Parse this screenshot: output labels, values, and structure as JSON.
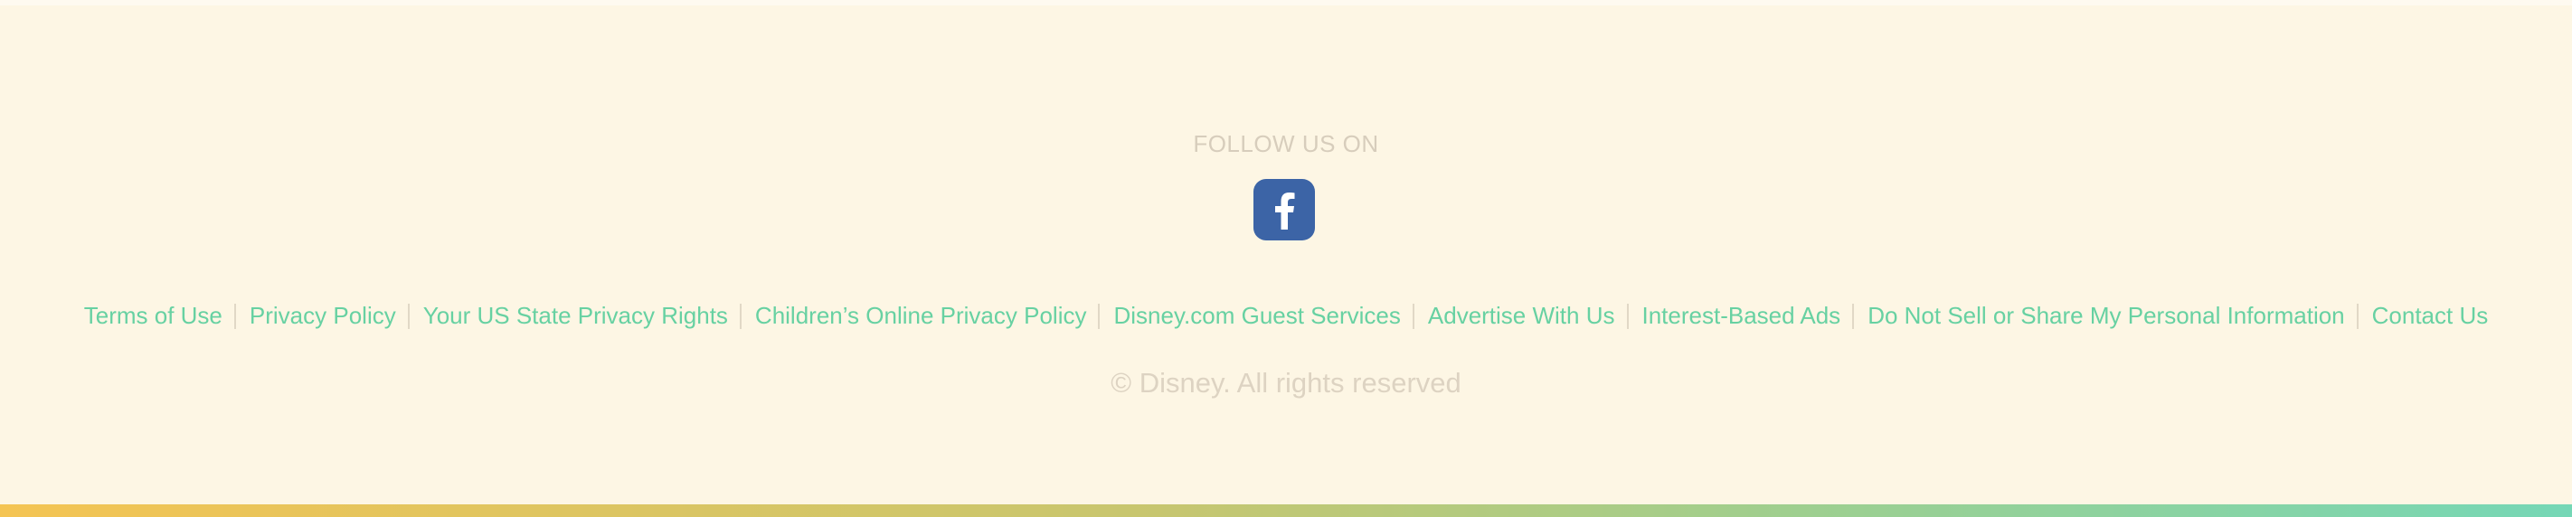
{
  "footer": {
    "follow_label": "FOLLOW US ON",
    "social": [
      {
        "name": "Facebook",
        "icon": "facebook-icon",
        "color": "#3c64a6"
      }
    ],
    "links": [
      "Terms of Use",
      "Privacy Policy",
      "Your US State Privacy Rights",
      "Children’s Online Privacy Policy",
      "Disney.com Guest Services",
      "Advertise With Us",
      "Interest-Based Ads",
      "Do Not Sell or Share My Personal Information",
      "Contact Us"
    ],
    "copyright": "© Disney. All rights reserved"
  },
  "colors": {
    "background": "#fdf6e4",
    "link": "#67d1a2",
    "muted_text": "#d7cdbc",
    "gradient_start": "#f4c453",
    "gradient_end": "#75d7b6"
  }
}
